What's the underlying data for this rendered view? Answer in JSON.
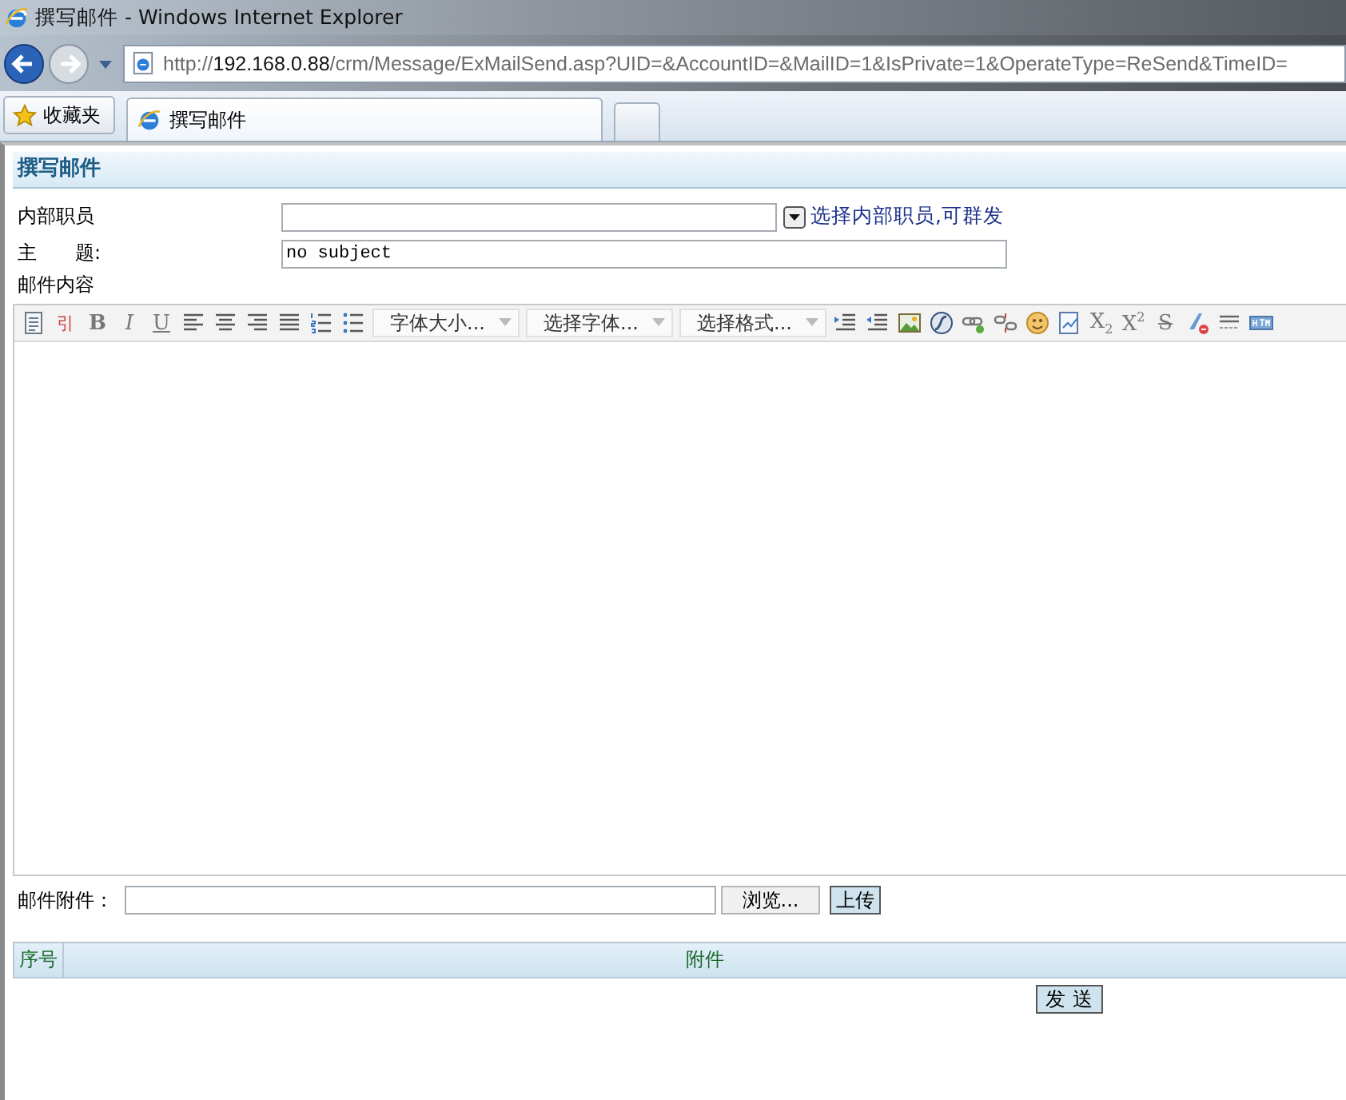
{
  "window": {
    "title": "撰写邮件 - Windows Internet Explorer"
  },
  "address_bar": {
    "url_prefix": "http://",
    "url_host": "192.168.0.88",
    "url_path": "/crm/Message/ExMailSend.asp?UID=&AccountID=&MailID=1&IsPrivate=1&OperateType=ReSend&TimeID="
  },
  "favorites": {
    "label": "收藏夹"
  },
  "tabs": [
    {
      "title": "撰写邮件",
      "selected": true
    }
  ],
  "page": {
    "heading": "撰写邮件",
    "recipient": {
      "label": "内部职员",
      "link": "选择内部职员,可群发"
    },
    "subject": {
      "label": "主　　题:",
      "value": "no subject"
    },
    "content_label": "邮件内容",
    "toolbar": [
      {
        "kind": "source"
      },
      {
        "kind": "quote",
        "text": "引"
      },
      {
        "kind": "bold",
        "text": "B"
      },
      {
        "kind": "italic",
        "text": "I"
      },
      {
        "kind": "underline",
        "text": "U"
      },
      {
        "kind": "align-left"
      },
      {
        "kind": "align-center"
      },
      {
        "kind": "align-right"
      },
      {
        "kind": "align-justify"
      },
      {
        "kind": "numbered-list"
      },
      {
        "kind": "bullet-list"
      },
      {
        "kind": "select",
        "text": "字体大小..."
      },
      {
        "kind": "select",
        "text": "选择字体..."
      },
      {
        "kind": "select",
        "text": "选择格式..."
      },
      {
        "kind": "indent"
      },
      {
        "kind": "outdent"
      },
      {
        "kind": "image"
      },
      {
        "kind": "flash"
      },
      {
        "kind": "link"
      },
      {
        "kind": "unlink"
      },
      {
        "kind": "emoticon"
      },
      {
        "kind": "document"
      },
      {
        "kind": "subscript",
        "text": "X$_{2}$"
      },
      {
        "kind": "superscript",
        "text": "X$^{2}$"
      },
      {
        "kind": "strike",
        "text": "S"
      },
      {
        "kind": "clear-format"
      },
      {
        "kind": "rule"
      },
      {
        "kind": "html"
      }
    ],
    "attachment": {
      "label": "邮件附件：",
      "browse": "浏览...",
      "upload": "上传"
    },
    "table": {
      "columns": [
        "序号",
        "附件"
      ]
    },
    "send": "发 送"
  }
}
